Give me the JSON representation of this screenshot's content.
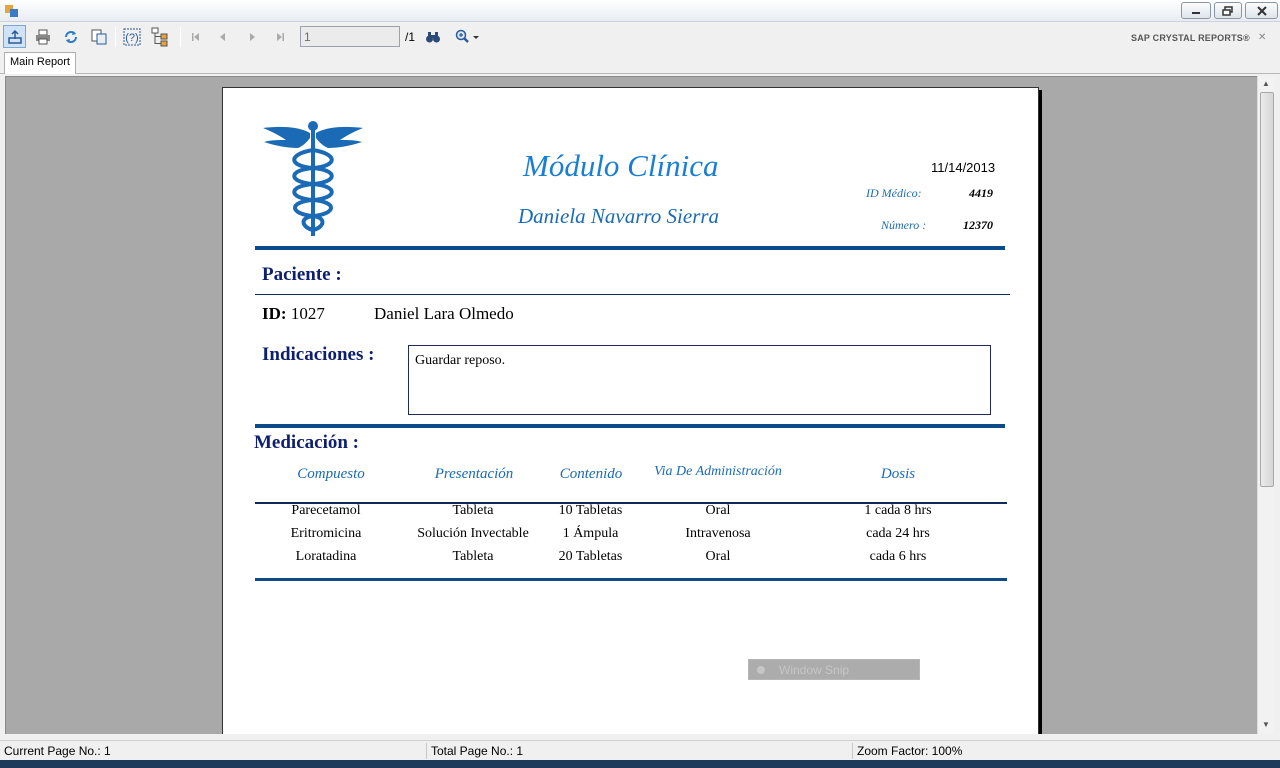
{
  "toolbar": {
    "page_input_value": "1",
    "page_total": "/1",
    "brand": "SAP CRYSTAL REPORTS®"
  },
  "tabs": {
    "main_report": "Main Report"
  },
  "report": {
    "title": "Módulo Clínica",
    "doctor_name": "Daniela Navarro Sierra",
    "date": "11/14/2013",
    "id_medico_label": "ID Médico:",
    "id_medico_value": "4419",
    "numero_label": "Número :",
    "numero_value": "12370",
    "paciente_heading": "Paciente :",
    "patient_id_label": "ID:",
    "patient_id_value": "1027",
    "patient_name": "Daniel Lara Olmedo",
    "indicaciones_heading": "Indicaciones :",
    "indicaciones_text": "Guardar reposo.",
    "medicacion_heading": "Medicación :",
    "columns": [
      "Compuesto",
      "Presentación",
      "Contenido",
      "Via De Administración",
      "Dosis"
    ],
    "rows": [
      [
        "Parecetamol",
        "Tableta",
        "10 Tabletas",
        "Oral",
        "1 cada 8 hrs"
      ],
      [
        "Eritromicina",
        "Solución Invectable",
        "1 Ámpula",
        "Intravenosa",
        "cada 24 hrs"
      ],
      [
        "Loratadina",
        "Tableta",
        "20 Tabletas",
        "Oral",
        "cada 6 hrs"
      ]
    ]
  },
  "overlay": {
    "window_snip": "Window Snip"
  },
  "status": {
    "current_page": "Current Page No.: 1",
    "total_page": "Total Page No.: 1",
    "zoom": "Zoom Factor: 100%"
  },
  "colors": {
    "report_accent": "#1a7ed4",
    "rule": "#0d4a8a",
    "section": "#0d1f6e",
    "viewer_bg": "#a9a9a9"
  },
  "icons": [
    "export-icon",
    "print-icon",
    "refresh-icon",
    "copy-icon",
    "help-icon",
    "group-tree-icon",
    "first-page-icon",
    "prev-page-icon",
    "next-page-icon",
    "last-page-icon",
    "find-icon",
    "zoom-icon",
    "caduceus-logo"
  ]
}
